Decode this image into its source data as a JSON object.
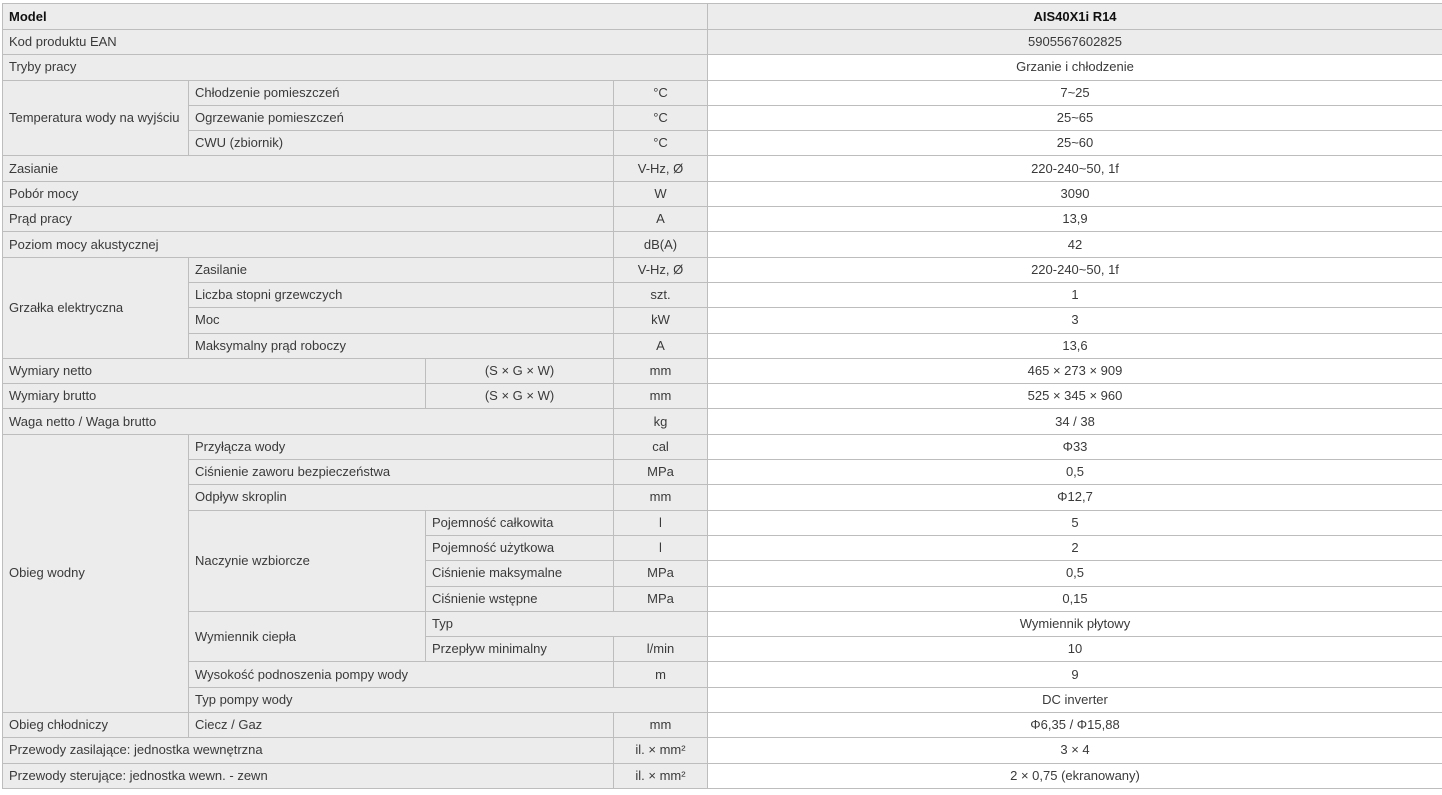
{
  "header": {
    "label": "Model",
    "model": "AIS40X1i R14"
  },
  "ean": {
    "label": "Kod produktu EAN",
    "value": "5905567602825"
  },
  "modes": {
    "label": "Tryby pracy",
    "value": "Grzanie i chłodzenie"
  },
  "water_temp": {
    "label": "Temperatura wody na wyjściu",
    "rows": [
      {
        "label": "Chłodzenie pomieszczeń",
        "unit": "°C",
        "value": "7~25"
      },
      {
        "label": "Ogrzewanie pomieszczeń",
        "unit": "°C",
        "value": "25~65"
      },
      {
        "label": "CWU (zbiornik)",
        "unit": "°C",
        "value": "25~60"
      }
    ]
  },
  "supply": {
    "label": "Zasianie",
    "unit": "V-Hz, Ø",
    "value": "220-240~50, 1f"
  },
  "power": {
    "label": "Pobór mocy",
    "unit": "W",
    "value": "3090"
  },
  "current": {
    "label": "Prąd pracy",
    "unit": "A",
    "value": "13,9"
  },
  "noise": {
    "label": "Poziom mocy akustycznej",
    "unit": "dB(A)",
    "value": "42"
  },
  "heater": {
    "label": "Grzałka elektryczna",
    "rows": [
      {
        "label": "Zasilanie",
        "unit": "V-Hz, Ø",
        "value": "220-240~50, 1f"
      },
      {
        "label": "Liczba stopni grzewczych",
        "unit": "szt.",
        "value": "1"
      },
      {
        "label": "Moc",
        "unit": "kW",
        "value": "3"
      },
      {
        "label": "Maksymalny prąd roboczy",
        "unit": "A",
        "value": "13,6"
      }
    ]
  },
  "dims_net": {
    "label": "Wymiary netto",
    "sub": "(S × G × W)",
    "unit": "mm",
    "value": "465 × 273 × 909"
  },
  "dims_gross": {
    "label": "Wymiary brutto",
    "sub": "(S × G × W)",
    "unit": "mm",
    "value": "525 × 345 × 960"
  },
  "weight": {
    "label": "Waga netto / Waga brutto",
    "unit": "kg",
    "value": "34 / 38"
  },
  "water_circuit": {
    "label": "Obieg wodny",
    "connections": {
      "label": "Przyłącza wody",
      "unit": "cal",
      "value": "Φ33"
    },
    "safety_valve": {
      "label": "Ciśnienie zaworu bezpieczeństwa",
      "unit": "MPa",
      "value": "0,5"
    },
    "drain": {
      "label": "Odpływ skroplin",
      "unit": "mm",
      "value": "Φ12,7"
    },
    "expansion": {
      "label": "Naczynie wzbiorcze",
      "rows": [
        {
          "label": "Pojemność całkowita",
          "unit": "l",
          "value": "5"
        },
        {
          "label": "Pojemność użytkowa",
          "unit": "l",
          "value": "2"
        },
        {
          "label": "Ciśnienie maksymalne",
          "unit": "MPa",
          "value": "0,5"
        },
        {
          "label": "Ciśnienie wstępne",
          "unit": "MPa",
          "value": "0,15"
        }
      ]
    },
    "exchanger": {
      "label": "Wymiennik ciepła",
      "type": {
        "label": "Typ",
        "value": "Wymiennik płytowy"
      },
      "min_flow": {
        "label": "Przepływ minimalny",
        "unit": "l/min",
        "value": "10"
      }
    },
    "pump_head": {
      "label": "Wysokość podnoszenia pompy wody",
      "unit": "m",
      "value": "9"
    },
    "pump_type": {
      "label": "Typ pompy wody",
      "value": "DC inverter"
    }
  },
  "refrigerant": {
    "label": "Obieg chłodniczy",
    "sub": "Ciecz / Gaz",
    "unit": "mm",
    "value": "Φ6,35 / Φ15,88"
  },
  "power_wires": {
    "label": "Przewody zasilające: jednostka wewnętrzna",
    "unit": "il. × mm²",
    "value": "3 × 4"
  },
  "control_wires": {
    "label": "Przewody sterujące: jednostka wewn. - zewn",
    "unit": "il. × mm²",
    "value": "2 × 0,75 (ekranowany)"
  }
}
